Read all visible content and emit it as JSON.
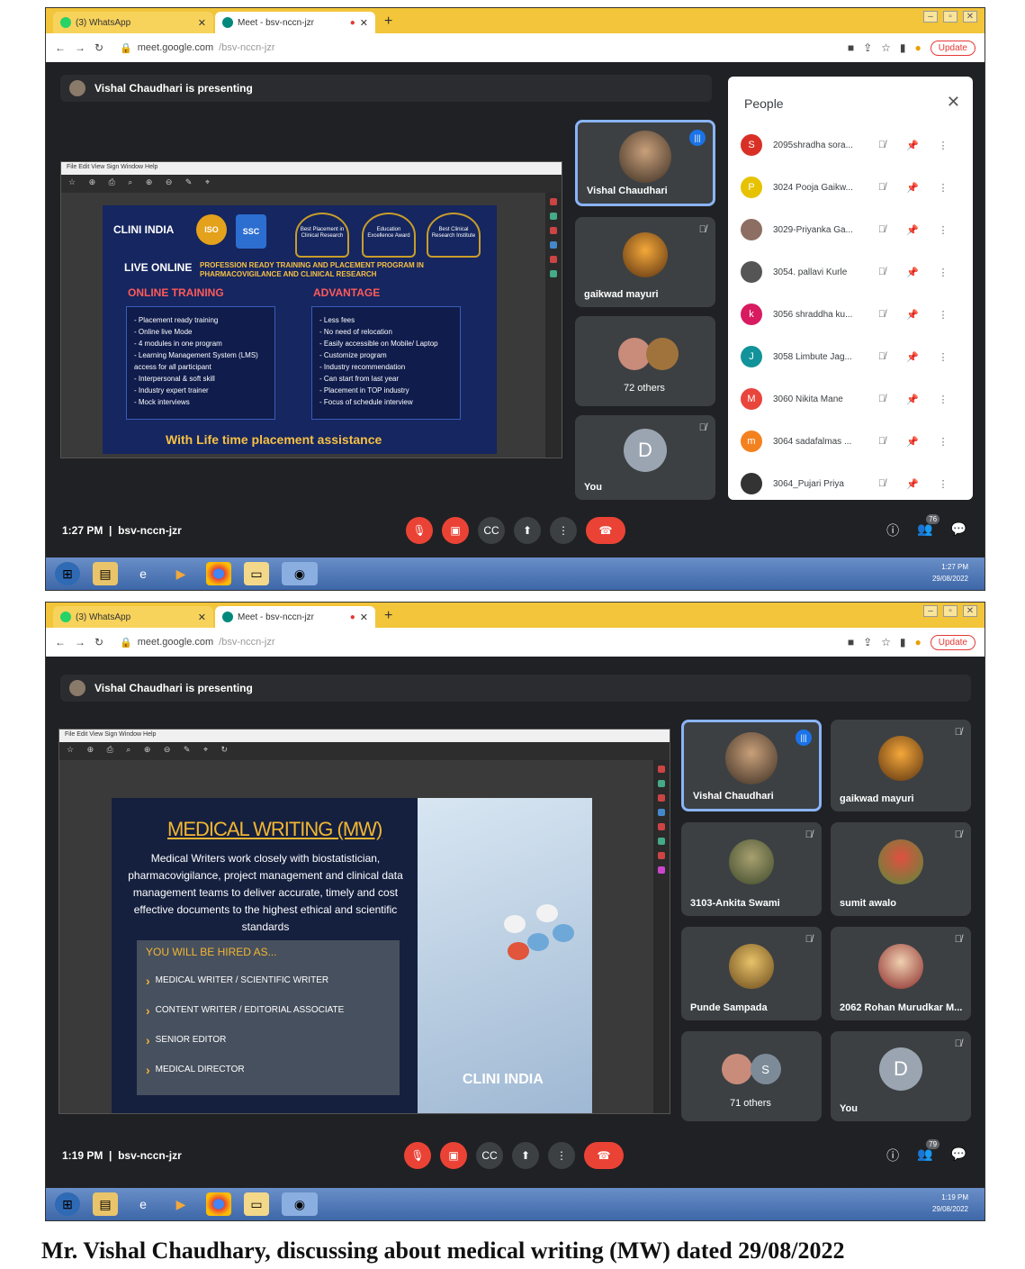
{
  "screenshot1": {
    "tabs": [
      {
        "label": "(3) WhatsApp"
      },
      {
        "label": "Meet - bsv-nccn-jzr"
      }
    ],
    "url_host": "meet.google.com",
    "url_path": "/bsv-nccn-jzr",
    "update_label": "Update",
    "presenting_text": "Vishal Chaudhari is presenting",
    "slide": {
      "logo": "CLINI INDIA",
      "iso": "ISO",
      "ssc": "SSC",
      "awards": [
        "Best Placement in Clinical Research",
        "Education Excellence Award",
        "Best Clinical Research Institute"
      ],
      "live": "LIVE ONLINE",
      "program": "PROFESSION READY TRAINING AND PLACEMENT PROGRAM IN PHARMACOVIGILANCE AND CLINICAL RESEARCH",
      "left_heading": "ONLINE TRAINING",
      "left_items": [
        "- Placement ready training",
        "- Online live Mode",
        "- 4 modules in one program",
        "- Learning Management System (LMS) access for all participant",
        "- Interpersonal & soft skill",
        "- Industry expert trainer",
        "- Mock interviews"
      ],
      "right_heading": "ADVANTAGE",
      "right_items": [
        "- Less fees",
        "- No need of relocation",
        "- Easily accessible on Mobile/ Laptop",
        "- Customize program",
        "- Industry recommendation",
        "- Can start from last year",
        "- Placement in TOP industry",
        "- Focus of schedule interview"
      ],
      "footer": "With Life time placement assistance"
    },
    "tiles": [
      {
        "name": "Vishal Chaudhari"
      },
      {
        "name": "gaikwad mayuri"
      },
      {
        "name": "72 others"
      },
      {
        "name": "You",
        "initial": "D"
      }
    ],
    "people_header": "People",
    "people": [
      {
        "initial": "S",
        "name": "2095shradha sora...",
        "color": "#d93025"
      },
      {
        "initial": "P",
        "name": "3024 Pooja Gaikw...",
        "color": "#e6c200"
      },
      {
        "initial": "",
        "name": "3029-Priyanka Ga...",
        "color": "#8d6e63"
      },
      {
        "initial": "",
        "name": "3054. pallavi Kurle",
        "color": "#555555"
      },
      {
        "initial": "k",
        "name": "3056 shraddha ku...",
        "color": "#d81b60"
      },
      {
        "initial": "J",
        "name": "3058 Limbute Jag...",
        "color": "#12939a"
      },
      {
        "initial": "M",
        "name": "3060 Nikita Mane",
        "color": "#e8453c"
      },
      {
        "initial": "m",
        "name": "3064 sadafalmas ...",
        "color": "#f4811f"
      },
      {
        "initial": "",
        "name": "3064_Pujari Priya",
        "color": "#333333"
      }
    ],
    "time": "1:27 PM",
    "meeting_code": "bsv-nccn-jzr",
    "participant_count": "76",
    "tray_time": "1:27 PM",
    "tray_date": "29/08/2022"
  },
  "screenshot2": {
    "tabs": [
      {
        "label": "(3) WhatsApp"
      },
      {
        "label": "Meet - bsv-nccn-jzr"
      }
    ],
    "url_host": "meet.google.com",
    "url_path": "/bsv-nccn-jzr",
    "update_label": "Update",
    "presenting_text": "Vishal Chaudhari is presenting",
    "slide": {
      "title": "MEDICAL WRITING (MW)",
      "paragraph": "Medical Writers work closely with biostatistician, pharmacovigilance, project management and clinical data management teams to deliver accurate, timely and cost effective documents to the highest ethical and scientific standards",
      "hired_heading": "YOU WILL BE HIRED AS...",
      "roles": [
        "MEDICAL WRITER / SCIENTIFIC WRITER",
        "CONTENT WRITER / EDITORIAL ASSOCIATE",
        "SENIOR EDITOR",
        "MEDICAL DIRECTOR"
      ],
      "logo": "CLINI INDIA"
    },
    "tiles": [
      {
        "name": "Vishal Chaudhari"
      },
      {
        "name": "gaikwad mayuri"
      },
      {
        "name": "3103-Ankita Swami"
      },
      {
        "name": "sumit awalo"
      },
      {
        "name": "Punde Sampada"
      },
      {
        "name": "2062 Rohan Murudkar M..."
      },
      {
        "name": "71 others",
        "initial": "S"
      },
      {
        "name": "You",
        "initial": "D"
      }
    ],
    "time": "1:19 PM",
    "meeting_code": "bsv-nccn-jzr",
    "participant_count": "79",
    "tray_time": "1:19 PM",
    "tray_date": "29/08/2022"
  },
  "caption": "Mr. Vishal Chaudhary, discussing about medical writing (MW) dated 29/08/2022"
}
